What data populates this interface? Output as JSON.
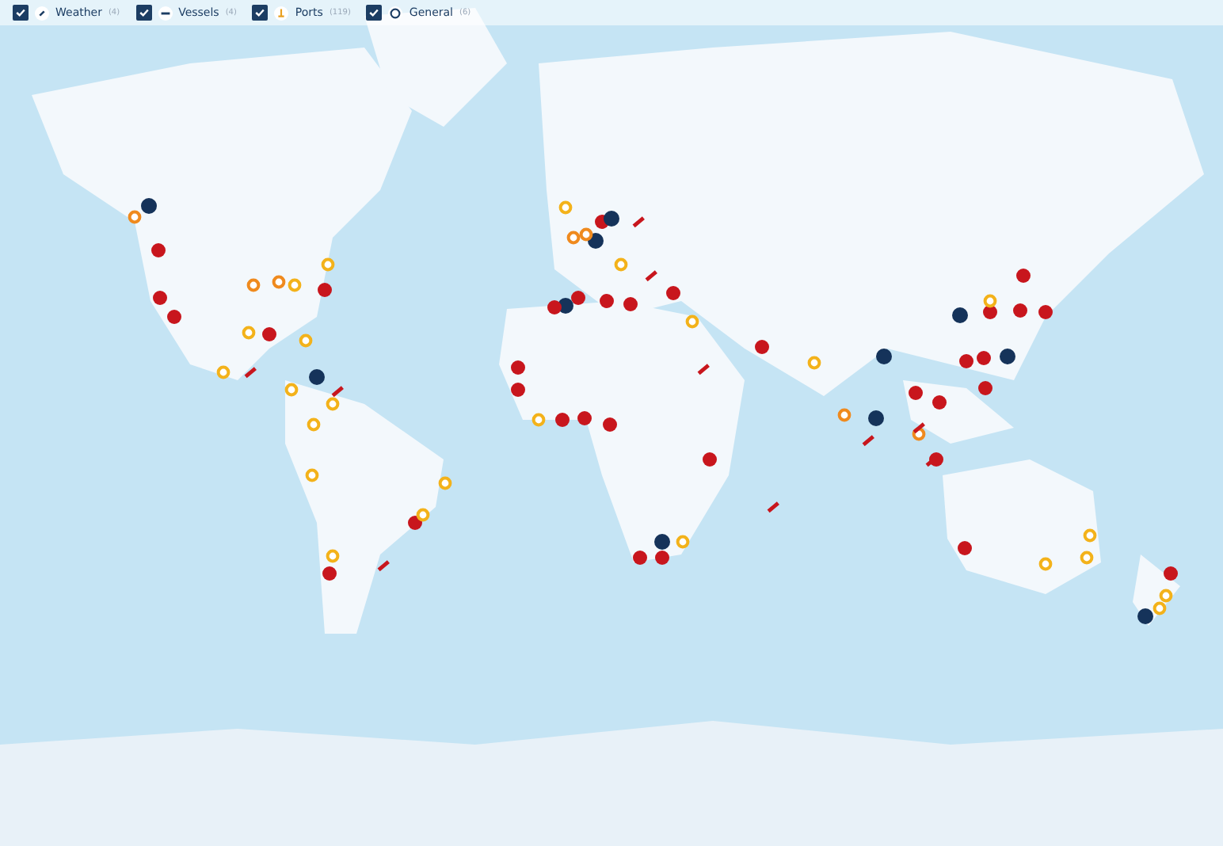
{
  "legend": [
    {
      "kind": "weather",
      "label": "Weather",
      "count": "(4)",
      "checked": true
    },
    {
      "kind": "vessel",
      "label": "Vessels",
      "count": "(4)",
      "checked": true
    },
    {
      "kind": "port",
      "label": "Ports",
      "count": "(119)",
      "checked": true
    },
    {
      "kind": "general",
      "label": "General",
      "count": "(6)",
      "checked": true
    }
  ]
}
